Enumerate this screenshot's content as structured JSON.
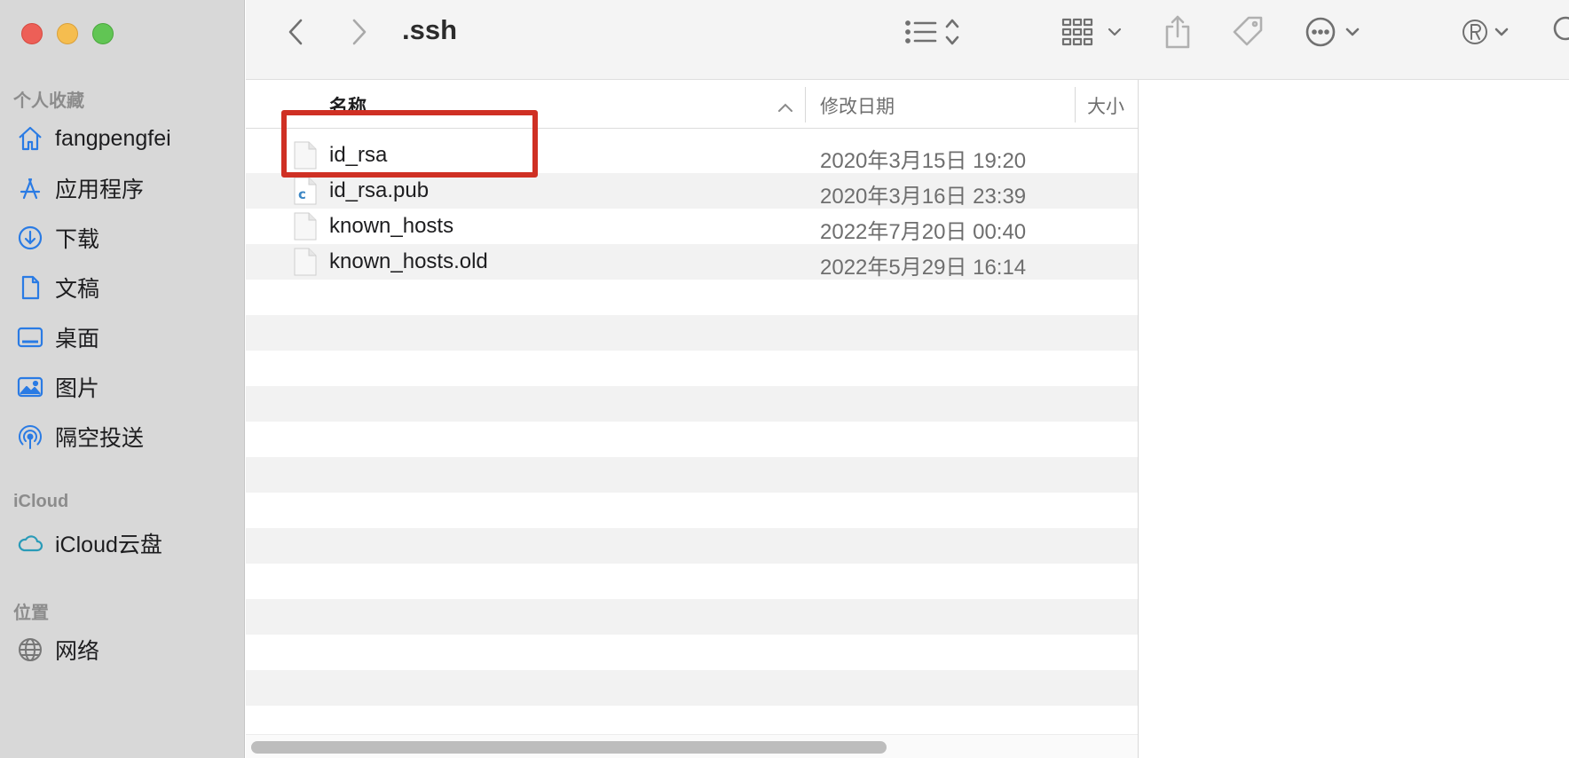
{
  "window": {
    "title": ".ssh"
  },
  "sidebar": {
    "favorites_title": "个人收藏",
    "favorites": [
      {
        "label": "fangpengfei",
        "icon": "home-icon"
      },
      {
        "label": "应用程序",
        "icon": "applications-icon"
      },
      {
        "label": "下载",
        "icon": "download-icon"
      },
      {
        "label": "文稿",
        "icon": "document-icon"
      },
      {
        "label": "桌面",
        "icon": "desktop-icon"
      },
      {
        "label": "图片",
        "icon": "photo-icon"
      },
      {
        "label": "隔空投送",
        "icon": "airdrop-icon"
      }
    ],
    "icloud_title": "iCloud",
    "icloud": [
      {
        "label": "iCloud云盘",
        "icon": "cloud-icon"
      }
    ],
    "locations_title": "位置",
    "locations": [
      {
        "label": "网络",
        "icon": "globe-icon"
      }
    ]
  },
  "toolbar": {
    "icons": [
      "back-icon",
      "forward-icon",
      "list-view-icon",
      "group-icon",
      "share-icon",
      "tag-icon",
      "more-icon",
      "registered-icon",
      "search-icon"
    ]
  },
  "list": {
    "columns": {
      "name": "名称",
      "date": "修改日期",
      "size": "大小"
    },
    "files": [
      {
        "name": "id_rsa",
        "date": "2020年3月15日 19:20",
        "icon": "document-icon"
      },
      {
        "name": "id_rsa.pub",
        "date": "2020年3月16日 23:39",
        "icon": "c-file-icon"
      },
      {
        "name": "known_hosts",
        "date": "2022年7月20日 00:40",
        "icon": "document-icon"
      },
      {
        "name": "known_hosts.old",
        "date": "2022年5月29日 16:14",
        "icon": "document-icon"
      }
    ]
  },
  "colors": {
    "highlight": "#cf3024",
    "sidebar_icon": "#2a7be4"
  }
}
